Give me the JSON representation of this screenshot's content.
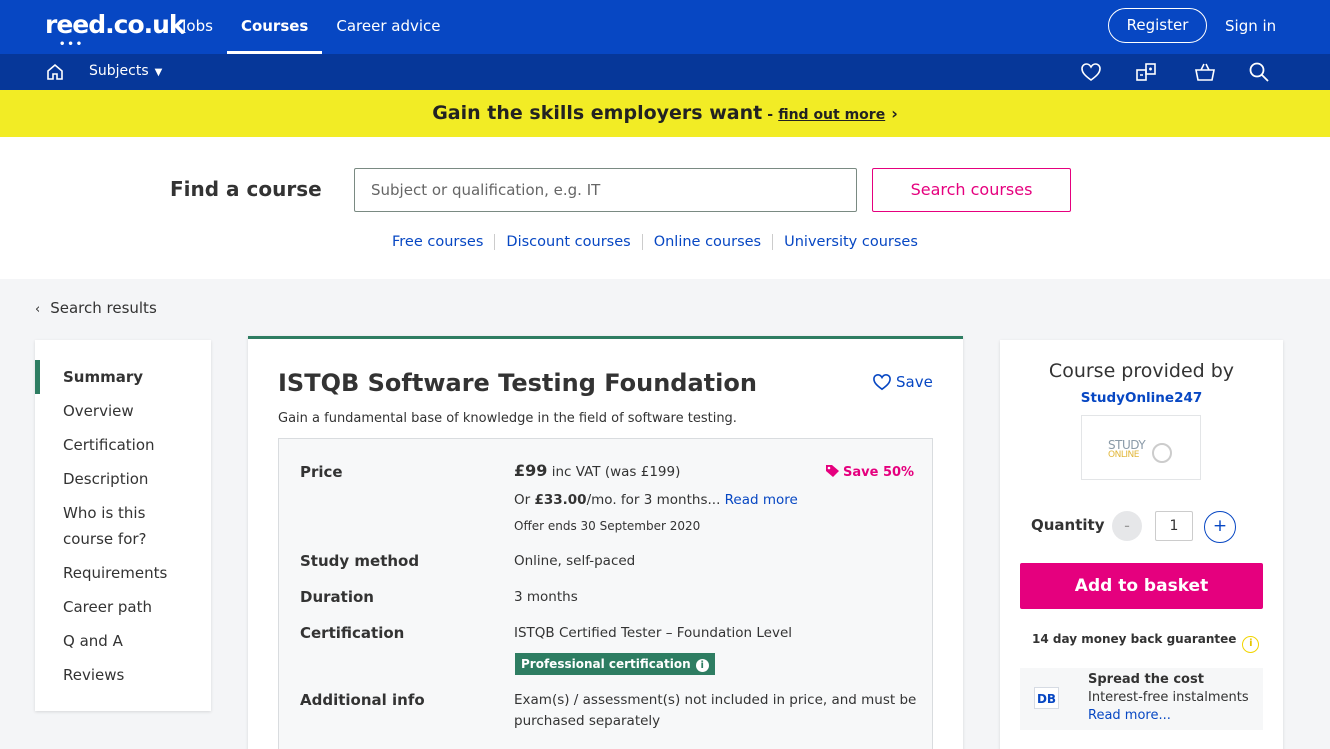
{
  "header": {
    "logo": "reed.co.uk",
    "nav": [
      "Jobs",
      "Courses",
      "Career advice"
    ],
    "active_nav": "Courses",
    "register_label": "Register",
    "signin_label": "Sign in"
  },
  "subbar": {
    "subjects_label": "Subjects",
    "icons": [
      "home-icon",
      "heart-icon",
      "compare-icon",
      "basket-icon",
      "search-icon"
    ]
  },
  "promo": {
    "headline": "Gain the skills employers want",
    "separator": "-",
    "link": "find out more"
  },
  "search": {
    "title": "Find a course",
    "placeholder": "Subject or qualification, e.g. IT",
    "button": "Search courses",
    "links": [
      "Free courses",
      "Discount courses",
      "Online courses",
      "University courses"
    ]
  },
  "back_label": "Search results",
  "sidenav": {
    "items": [
      "Summary",
      "Overview",
      "Certification",
      "Description",
      "Who is this",
      "course for?",
      "Requirements",
      "Career path",
      "Q and A",
      "Reviews"
    ]
  },
  "course": {
    "title": "ISTQB Software Testing Foundation",
    "subtitle": "Gain a fundamental base of knowledge in the field of software testing.",
    "save_label": "Save",
    "price_label": "Price",
    "price": "£99",
    "price_vat": "inc VAT (was £199)",
    "save_tag": "Save 50%",
    "finance_prefix": "Or",
    "finance_amount": "£33.00",
    "finance_suffix": "/mo. for 3 months...",
    "read_more": "Read more",
    "offer_ends": "Offer ends 30 September 2020",
    "study_method_label": "Study method",
    "study_method": "Online, self-paced",
    "duration_label": "Duration",
    "duration": "3 months",
    "certification_label": "Certification",
    "certification": "ISTQB Certified Tester – Foundation Level",
    "cert_badge": "Professional certification",
    "additional_label": "Additional info",
    "additional_1": "Exam(s) / assessment(s) not included in price, and must be",
    "additional_2": "purchased separately"
  },
  "provider": {
    "title": "Course provided by",
    "name": "StudyOnline247",
    "logo_line1": "STUDY",
    "logo_line2": "ONLINE",
    "quantity_label": "Quantity",
    "quantity": "1",
    "minus": "-",
    "plus": "+",
    "basket_label": "Add to basket",
    "guarantee": "14 day money back guarantee",
    "spread_title": "Spread the cost",
    "spread_sub": "Interest-free instalments",
    "spread_link": "Read more...",
    "db_logo": "DB"
  },
  "colors": {
    "brand_blue": "#0747c3",
    "promo_yellow": "#f2ec25",
    "accent_pink": "#e5007e",
    "accent_green": "#2e7d62"
  }
}
